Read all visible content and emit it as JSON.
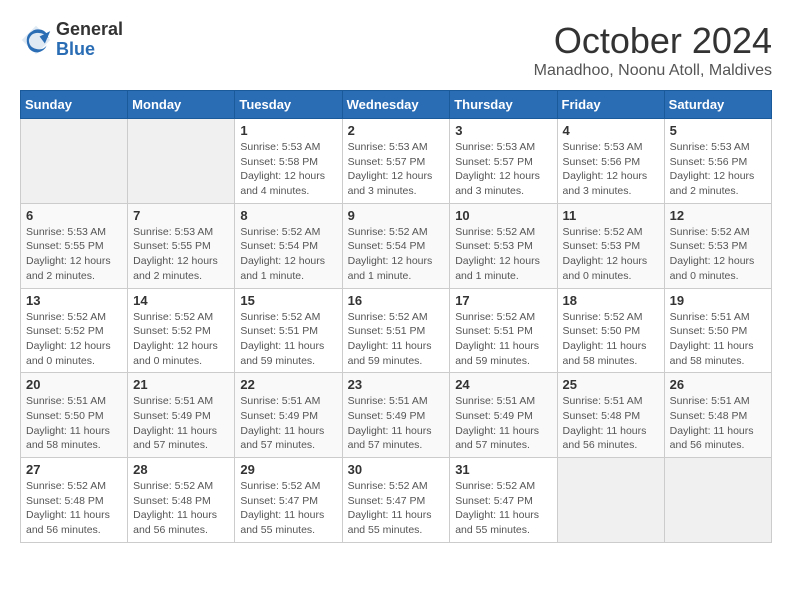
{
  "header": {
    "logo_general": "General",
    "logo_blue": "Blue",
    "month_title": "October 2024",
    "subtitle": "Manadhoo, Noonu Atoll, Maldives"
  },
  "days_of_week": [
    "Sunday",
    "Monday",
    "Tuesday",
    "Wednesday",
    "Thursday",
    "Friday",
    "Saturday"
  ],
  "weeks": [
    [
      {
        "day": "",
        "info": ""
      },
      {
        "day": "",
        "info": ""
      },
      {
        "day": "1",
        "info": "Sunrise: 5:53 AM\nSunset: 5:58 PM\nDaylight: 12 hours and 4 minutes."
      },
      {
        "day": "2",
        "info": "Sunrise: 5:53 AM\nSunset: 5:57 PM\nDaylight: 12 hours and 3 minutes."
      },
      {
        "day": "3",
        "info": "Sunrise: 5:53 AM\nSunset: 5:57 PM\nDaylight: 12 hours and 3 minutes."
      },
      {
        "day": "4",
        "info": "Sunrise: 5:53 AM\nSunset: 5:56 PM\nDaylight: 12 hours and 3 minutes."
      },
      {
        "day": "5",
        "info": "Sunrise: 5:53 AM\nSunset: 5:56 PM\nDaylight: 12 hours and 2 minutes."
      }
    ],
    [
      {
        "day": "6",
        "info": "Sunrise: 5:53 AM\nSunset: 5:55 PM\nDaylight: 12 hours and 2 minutes."
      },
      {
        "day": "7",
        "info": "Sunrise: 5:53 AM\nSunset: 5:55 PM\nDaylight: 12 hours and 2 minutes."
      },
      {
        "day": "8",
        "info": "Sunrise: 5:52 AM\nSunset: 5:54 PM\nDaylight: 12 hours and 1 minute."
      },
      {
        "day": "9",
        "info": "Sunrise: 5:52 AM\nSunset: 5:54 PM\nDaylight: 12 hours and 1 minute."
      },
      {
        "day": "10",
        "info": "Sunrise: 5:52 AM\nSunset: 5:53 PM\nDaylight: 12 hours and 1 minute."
      },
      {
        "day": "11",
        "info": "Sunrise: 5:52 AM\nSunset: 5:53 PM\nDaylight: 12 hours and 0 minutes."
      },
      {
        "day": "12",
        "info": "Sunrise: 5:52 AM\nSunset: 5:53 PM\nDaylight: 12 hours and 0 minutes."
      }
    ],
    [
      {
        "day": "13",
        "info": "Sunrise: 5:52 AM\nSunset: 5:52 PM\nDaylight: 12 hours and 0 minutes."
      },
      {
        "day": "14",
        "info": "Sunrise: 5:52 AM\nSunset: 5:52 PM\nDaylight: 12 hours and 0 minutes."
      },
      {
        "day": "15",
        "info": "Sunrise: 5:52 AM\nSunset: 5:51 PM\nDaylight: 11 hours and 59 minutes."
      },
      {
        "day": "16",
        "info": "Sunrise: 5:52 AM\nSunset: 5:51 PM\nDaylight: 11 hours and 59 minutes."
      },
      {
        "day": "17",
        "info": "Sunrise: 5:52 AM\nSunset: 5:51 PM\nDaylight: 11 hours and 59 minutes."
      },
      {
        "day": "18",
        "info": "Sunrise: 5:52 AM\nSunset: 5:50 PM\nDaylight: 11 hours and 58 minutes."
      },
      {
        "day": "19",
        "info": "Sunrise: 5:51 AM\nSunset: 5:50 PM\nDaylight: 11 hours and 58 minutes."
      }
    ],
    [
      {
        "day": "20",
        "info": "Sunrise: 5:51 AM\nSunset: 5:50 PM\nDaylight: 11 hours and 58 minutes."
      },
      {
        "day": "21",
        "info": "Sunrise: 5:51 AM\nSunset: 5:49 PM\nDaylight: 11 hours and 57 minutes."
      },
      {
        "day": "22",
        "info": "Sunrise: 5:51 AM\nSunset: 5:49 PM\nDaylight: 11 hours and 57 minutes."
      },
      {
        "day": "23",
        "info": "Sunrise: 5:51 AM\nSunset: 5:49 PM\nDaylight: 11 hours and 57 minutes."
      },
      {
        "day": "24",
        "info": "Sunrise: 5:51 AM\nSunset: 5:49 PM\nDaylight: 11 hours and 57 minutes."
      },
      {
        "day": "25",
        "info": "Sunrise: 5:51 AM\nSunset: 5:48 PM\nDaylight: 11 hours and 56 minutes."
      },
      {
        "day": "26",
        "info": "Sunrise: 5:51 AM\nSunset: 5:48 PM\nDaylight: 11 hours and 56 minutes."
      }
    ],
    [
      {
        "day": "27",
        "info": "Sunrise: 5:52 AM\nSunset: 5:48 PM\nDaylight: 11 hours and 56 minutes."
      },
      {
        "day": "28",
        "info": "Sunrise: 5:52 AM\nSunset: 5:48 PM\nDaylight: 11 hours and 56 minutes."
      },
      {
        "day": "29",
        "info": "Sunrise: 5:52 AM\nSunset: 5:47 PM\nDaylight: 11 hours and 55 minutes."
      },
      {
        "day": "30",
        "info": "Sunrise: 5:52 AM\nSunset: 5:47 PM\nDaylight: 11 hours and 55 minutes."
      },
      {
        "day": "31",
        "info": "Sunrise: 5:52 AM\nSunset: 5:47 PM\nDaylight: 11 hours and 55 minutes."
      },
      {
        "day": "",
        "info": ""
      },
      {
        "day": "",
        "info": ""
      }
    ]
  ]
}
